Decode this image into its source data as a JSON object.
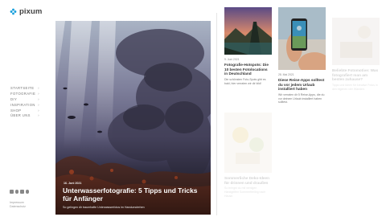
{
  "brand": {
    "name": "pixum",
    "icon": "pixum-flower-logo",
    "accent": "#1aa0dc"
  },
  "nav": {
    "items": [
      {
        "label": "STARTSEITE"
      },
      {
        "label": "FOTOGRAFIE"
      },
      {
        "label": "DIY"
      },
      {
        "label": "INSPIRATION"
      },
      {
        "label": "SHOP"
      },
      {
        "label": "ÜBER UNS"
      }
    ],
    "chevron": "›"
  },
  "social": [
    "facebook-icon",
    "instagram-icon",
    "youtube-icon",
    "pinterest-icon"
  ],
  "footer": {
    "line1": "Impressum",
    "line2": "Datenschutz"
  },
  "featured": {
    "date": "16. Juni 2021",
    "title": "Unterwasserfotografie: 5 Tipps und Tricks für Anfänger",
    "subtitle": "So gelingen dir traumhafte Unterwasserfotos im Handumdrehen"
  },
  "cards": [
    {
      "date": "9. Juni 2021",
      "title": "Fotografie-Hotspots: Die 10 besten Fotolocations in Deutschland",
      "text": "Die schönsten Foto-Spots gibt es bald, hier verraten wir dir bild!"
    },
    {
      "date": "28. Mai 2021",
      "title": "Diese Reise-Apps solltest du vor jedem Urlaub installiert haben",
      "text": "Wir verraten dir 5 Reise-Apps, die du vor deinem Urlaub installiert haben solltest."
    },
    {
      "date": "",
      "title": "Beliebte Fotomotive: Was fotografiert man am besten zuhause?",
      "text": "Tipps und Ideen für kreative Fotos in den eigenen vier Wänden."
    },
    {
      "date": "",
      "title": "Sommerliche Deko-Ideen für drinnen und draußen",
      "text": "So bringst du mit wenigen Handgriffen Sommerfeeling nach Hause."
    }
  ]
}
